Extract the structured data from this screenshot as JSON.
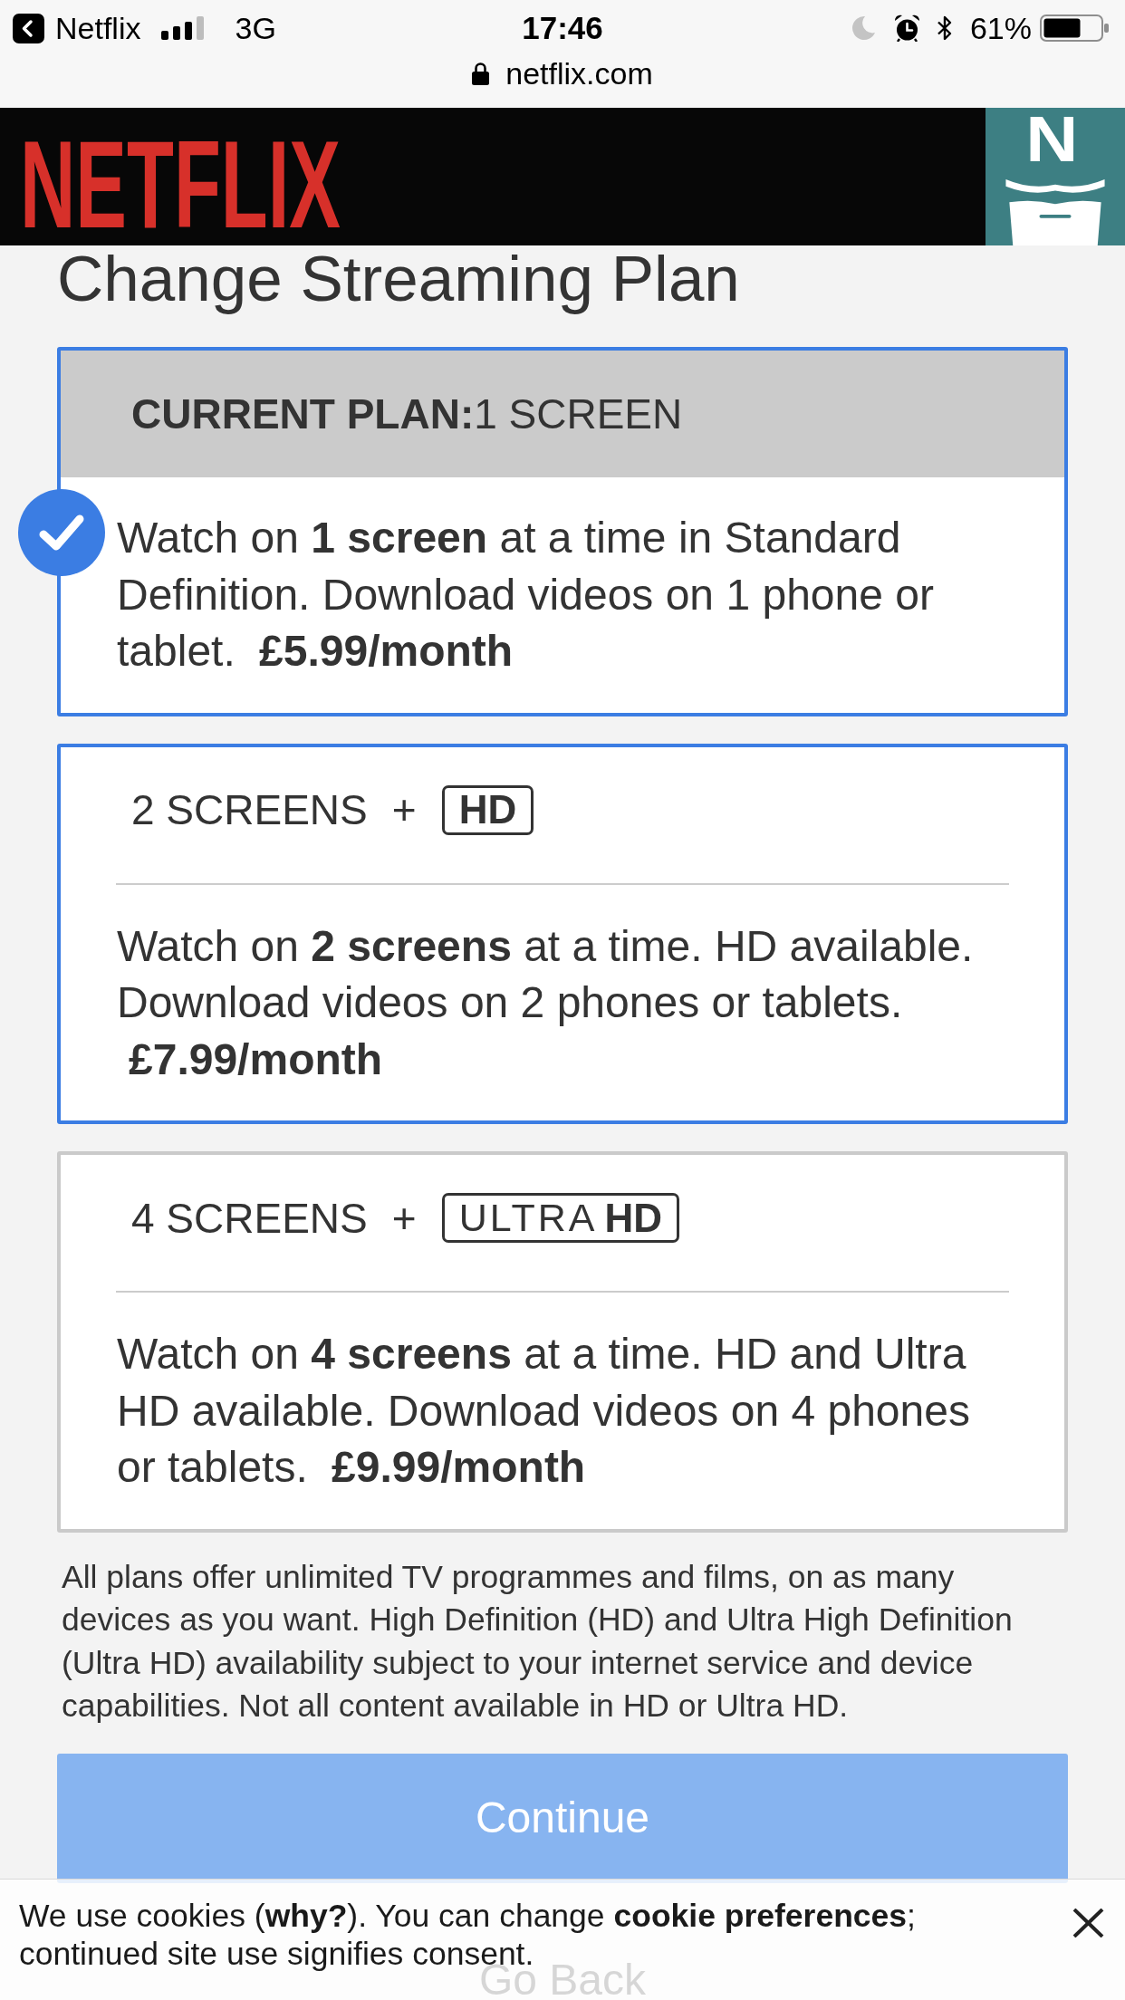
{
  "status_bar": {
    "back_app": "Netflix",
    "network": "3G",
    "time": "17:46",
    "battery": "61%",
    "url": "netflix.com"
  },
  "header": {
    "logo": "NETFLIX",
    "avatar_letter": "N"
  },
  "title": "Change Streaming Plan",
  "plans": [
    {
      "kind": "current",
      "heading": "**CURRENT PLAN:**1 SCREEN",
      "description": "Watch on **1 screen** at a time in Standard Definition. Download videos on 1 phone or tablet.",
      "price": "£5.99/month",
      "selected": true,
      "highlighted": true
    },
    {
      "kind": "option",
      "label": "2 SCREENS",
      "plus": "+",
      "badge": [
        {
          "text": "HD",
          "bold": true
        }
      ],
      "description": "Watch on **2 screens** at a time. HD available. Download videos on 2 phones or tablets.",
      "price": "£7.99/month",
      "selected": false,
      "highlighted": true
    },
    {
      "kind": "option",
      "label": "4 SCREENS",
      "plus": "+",
      "badge": [
        {
          "text": "ULTRA",
          "bold": false
        },
        {
          "text": "HD",
          "bold": true
        }
      ],
      "description": "Watch on **4 screens** at a time. HD and Ultra HD available. Download videos on 4 phones or tablets.",
      "price": "£9.99/month",
      "selected": false,
      "highlighted": false
    }
  ],
  "disclaimer": "All plans offer unlimited TV programmes and films, on as many devices as you want. High Definition (HD) and Ultra High Definition (Ultra HD) availability subject to your internet service and device capabilities. Not all content available in HD or Ultra HD.",
  "buttons": [
    {
      "label": "Continue",
      "kind": "primary",
      "disabled": true
    },
    {
      "label": "Go Back",
      "kind": "secondary",
      "disabled": false
    }
  ],
  "cookie_banner": {
    "segments": [
      {
        "kind": "text",
        "text": "We use cookies ("
      },
      {
        "kind": "link",
        "text": "why?"
      },
      {
        "kind": "text",
        "text": "). You can change "
      },
      {
        "kind": "link",
        "text": "cookie preferences"
      },
      {
        "kind": "text",
        "text": "; continued site use signifies consent."
      }
    ]
  }
}
